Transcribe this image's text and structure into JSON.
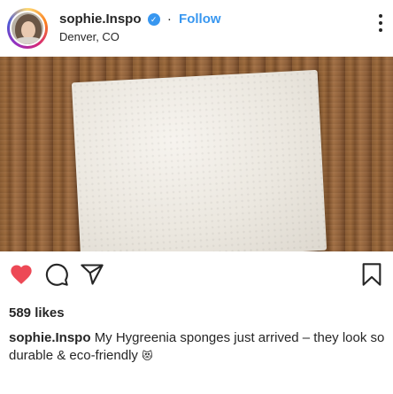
{
  "post": {
    "username": "sophie.Inspo",
    "verified_icon": "verified-badge-icon",
    "separator": "·",
    "follow_label": "Follow",
    "location": "Denver, CO",
    "more_icon": "more-options-icon",
    "photo_description_icon": "post-photo",
    "likes": "589 likes",
    "caption_username": "sophie.Inspo",
    "caption_text": "My Hygreenia sponges just arrived – they look so durable & eco-friendly",
    "caption_emoji": "😻"
  },
  "actions": {
    "like_icon": "heart-filled-icon",
    "comment_icon": "comment-icon",
    "share_icon": "share-icon",
    "save_icon": "bookmark-icon"
  },
  "colors": {
    "accent_blue": "#3897f0",
    "like_red": "#ed4956",
    "text": "#262626"
  }
}
